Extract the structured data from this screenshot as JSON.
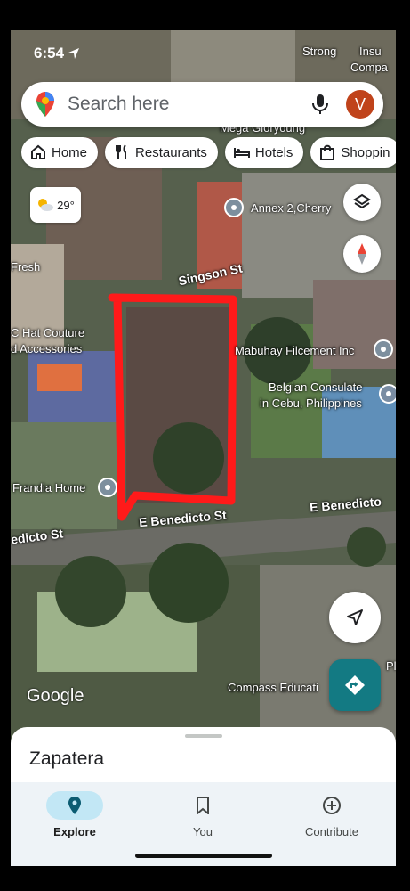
{
  "status_bar": {
    "time": "6:54",
    "right_text": "Strong...Insu Compa"
  },
  "search": {
    "placeholder": "Search here",
    "avatar_letter": "V"
  },
  "chips": [
    {
      "label": "Home",
      "icon": "home-icon"
    },
    {
      "label": "Restaurants",
      "icon": "fork-knife-icon"
    },
    {
      "label": "Hotels",
      "icon": "bed-icon"
    },
    {
      "label": "Shoppin",
      "icon": "bag-icon"
    }
  ],
  "weather": {
    "temp": "29°"
  },
  "map_labels": {
    "mega": "Mega Gloryoung",
    "annex": "Annex 2,Cherry",
    "fresh": "Fresh",
    "hat": "C Hat Couture",
    "accessories": "d Accessories",
    "mabuhay": "Mabuhay Filcement Inc",
    "belgian1": "Belgian Consulate",
    "belgian2": "in Cebu, Philippines",
    "frandia": "Frandia Home",
    "compass": "Compass Educati",
    "pl": "Pl",
    "top_right_1": "Strong",
    "top_right_2": "Insu",
    "top_right_3": "Compa"
  },
  "roads": {
    "singson": "Singson St",
    "benedicto": "E Benedicto St",
    "benedicto_right": "E Benedicto",
    "benedicto_left": "edicto St"
  },
  "attribution": "Google",
  "sheet": {
    "place_name": "Zapatera"
  },
  "nav_tabs": [
    {
      "label": "Explore",
      "icon": "location-pin-icon",
      "active": true
    },
    {
      "label": "You",
      "icon": "bookmark-icon",
      "active": false
    },
    {
      "label": "Contribute",
      "icon": "plus-circle-icon",
      "active": false
    }
  ],
  "colors": {
    "annotation_red": "#ff1a1a",
    "directions_teal": "#137a83",
    "avatar": "#c0431b"
  }
}
